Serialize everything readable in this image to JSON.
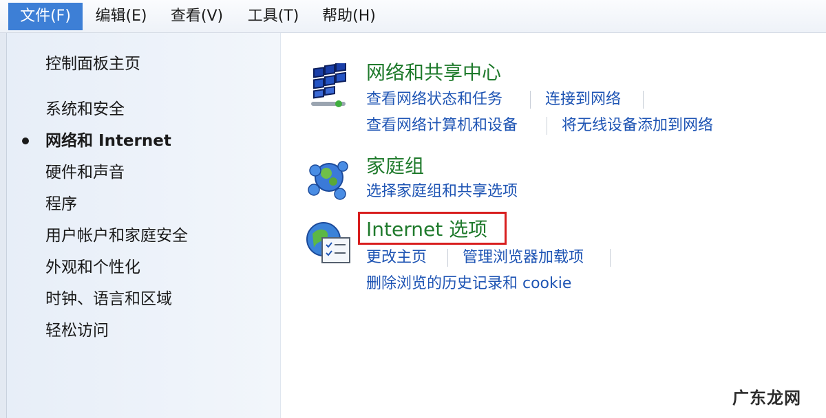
{
  "menubar": {
    "items": [
      {
        "label": "文件(F)",
        "active": true
      },
      {
        "label": "编辑(E)"
      },
      {
        "label": "查看(V)"
      },
      {
        "label": "工具(T)"
      },
      {
        "label": "帮助(H)"
      }
    ]
  },
  "sidebar": {
    "home": "控制面板主页",
    "items": [
      {
        "label": "系统和安全"
      },
      {
        "label": "网络和 Internet",
        "current": true
      },
      {
        "label": "硬件和声音"
      },
      {
        "label": "程序"
      },
      {
        "label": "用户帐户和家庭安全"
      },
      {
        "label": "外观和个性化"
      },
      {
        "label": "时钟、语言和区域"
      },
      {
        "label": "轻松访问"
      }
    ]
  },
  "categories": [
    {
      "title": "网络和共享中心",
      "icon": "network-icon",
      "links": [
        "查看网络状态和任务",
        "连接到网络",
        "查看网络计算机和设备",
        "将无线设备添加到网络"
      ]
    },
    {
      "title": "家庭组",
      "icon": "homegroup-icon",
      "links": [
        "选择家庭组和共享选项"
      ]
    },
    {
      "title": "Internet 选项",
      "icon": "internet-options-icon",
      "links": [
        "更改主页",
        "管理浏览器加载项",
        "删除浏览的历史记录和 cookie"
      ]
    }
  ],
  "watermark": "广东龙网",
  "colors": {
    "active_menu": "#3d7fd6",
    "category_title": "#1f7a2c",
    "link": "#1f55b4",
    "highlight": "#d81e1e"
  }
}
